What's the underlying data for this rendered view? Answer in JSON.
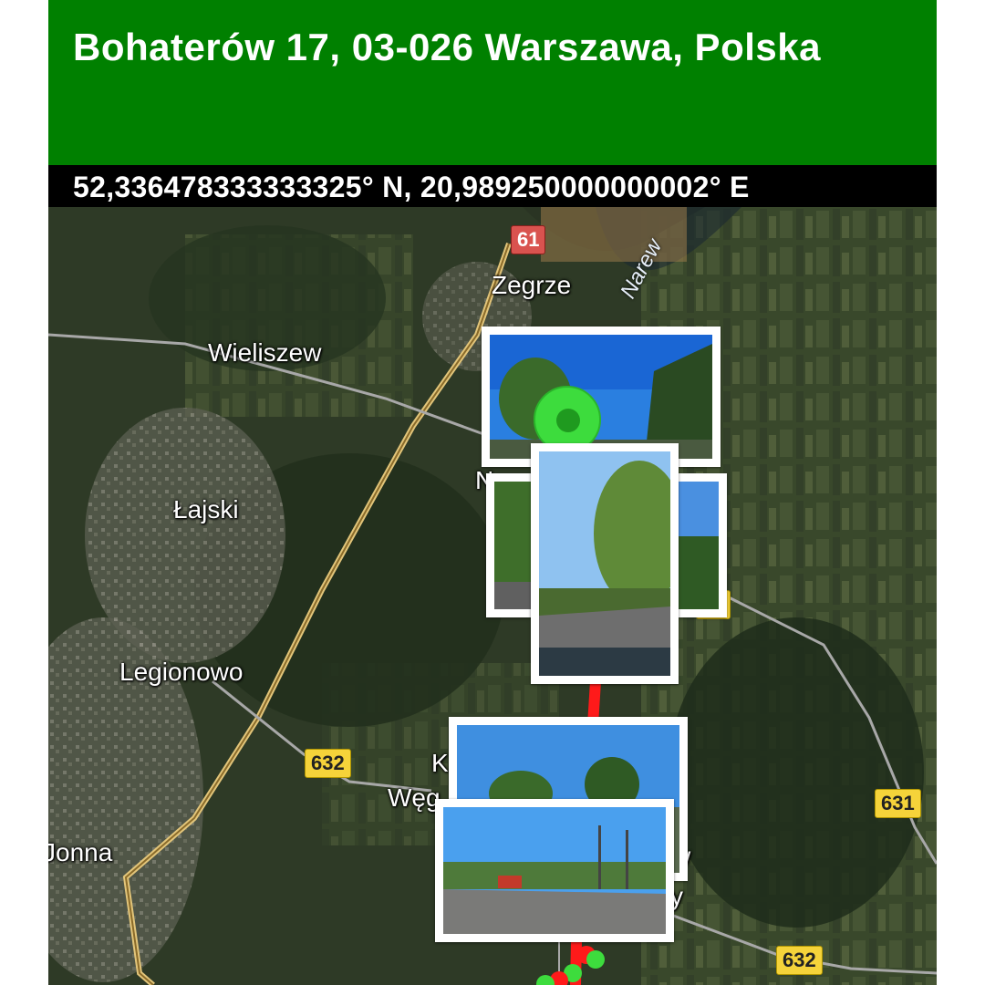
{
  "header": {
    "address": "Bohaterów 17, 03-026 Warszawa, Polska",
    "coordinates": "52,336478333333325° N, 20,989250000000002° E"
  },
  "map": {
    "places": {
      "zegrze": "Zegrze",
      "wieliszew": "Wieliszew",
      "lajski": "Łajski",
      "legionowo": "Legionowo",
      "jablonna": "Jonna",
      "wegrzynowo": "Węg",
      "k_fragment": "K",
      "n_fragment": "N",
      "w_fragment": "w",
      "y_fragment": "y"
    },
    "river": "Narew",
    "road_shields": {
      "r61": "61",
      "r632_left": "632",
      "r631_mid": "31",
      "r631_right": "631",
      "r632_bottom": "632"
    },
    "colors": {
      "header": "#008000",
      "route": "#ff1a1a",
      "pin": "#3ddc3d"
    }
  }
}
